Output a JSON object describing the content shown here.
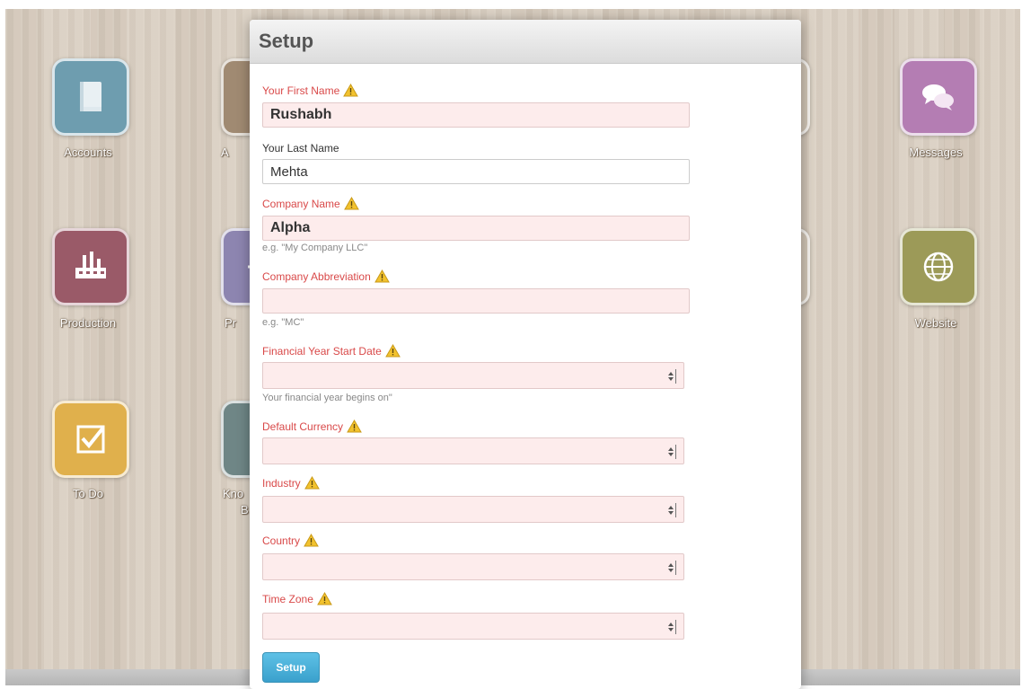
{
  "desktop": {
    "icons": [
      {
        "id": "accounts",
        "label": "Accounts",
        "color": "#6e9daf"
      },
      {
        "id": "a2",
        "label": "A",
        "color": "#a08a72"
      },
      {
        "id": "messages",
        "label": "Messages",
        "color": "#b47db3"
      },
      {
        "id": "production",
        "label": "Production",
        "color": "#9a5a68"
      },
      {
        "id": "p2",
        "label": "Pr",
        "color": "#8d85b0"
      },
      {
        "id": "website",
        "label": "Website",
        "color": "#9c9a58"
      },
      {
        "id": "todo",
        "label": "To Do",
        "color": "#e0b04c"
      },
      {
        "id": "k2",
        "label": "Kno",
        "label2": "B",
        "color": "#6f8686"
      }
    ]
  },
  "modal": {
    "title": "Setup",
    "fields": {
      "first_name": {
        "label": "Your First Name",
        "value": "Rushabh",
        "required": true
      },
      "last_name": {
        "label": "Your Last Name",
        "value": "Mehta",
        "required": false
      },
      "company_name": {
        "label": "Company Name",
        "value": "Alpha",
        "help": "e.g. \"My Company LLC\"",
        "required": true
      },
      "company_abbr": {
        "label": "Company Abbreviation",
        "value": "",
        "help": "e.g. \"MC\"",
        "required": true
      },
      "fy_start": {
        "label": "Financial Year Start Date",
        "value": "",
        "help": "Your financial year begins on\"",
        "required": true
      },
      "currency": {
        "label": "Default Currency",
        "value": "",
        "required": true
      },
      "industry": {
        "label": "Industry",
        "value": "",
        "required": true
      },
      "country": {
        "label": "Country",
        "value": "",
        "required": true
      },
      "time_zone": {
        "label": "Time Zone",
        "value": "",
        "required": true
      }
    },
    "submit_label": "Setup"
  },
  "colors": {
    "required_label": "#d94949",
    "required_field_bg": "#fdecec",
    "button": "#3aa0cc",
    "warning": "#f2c22e"
  }
}
